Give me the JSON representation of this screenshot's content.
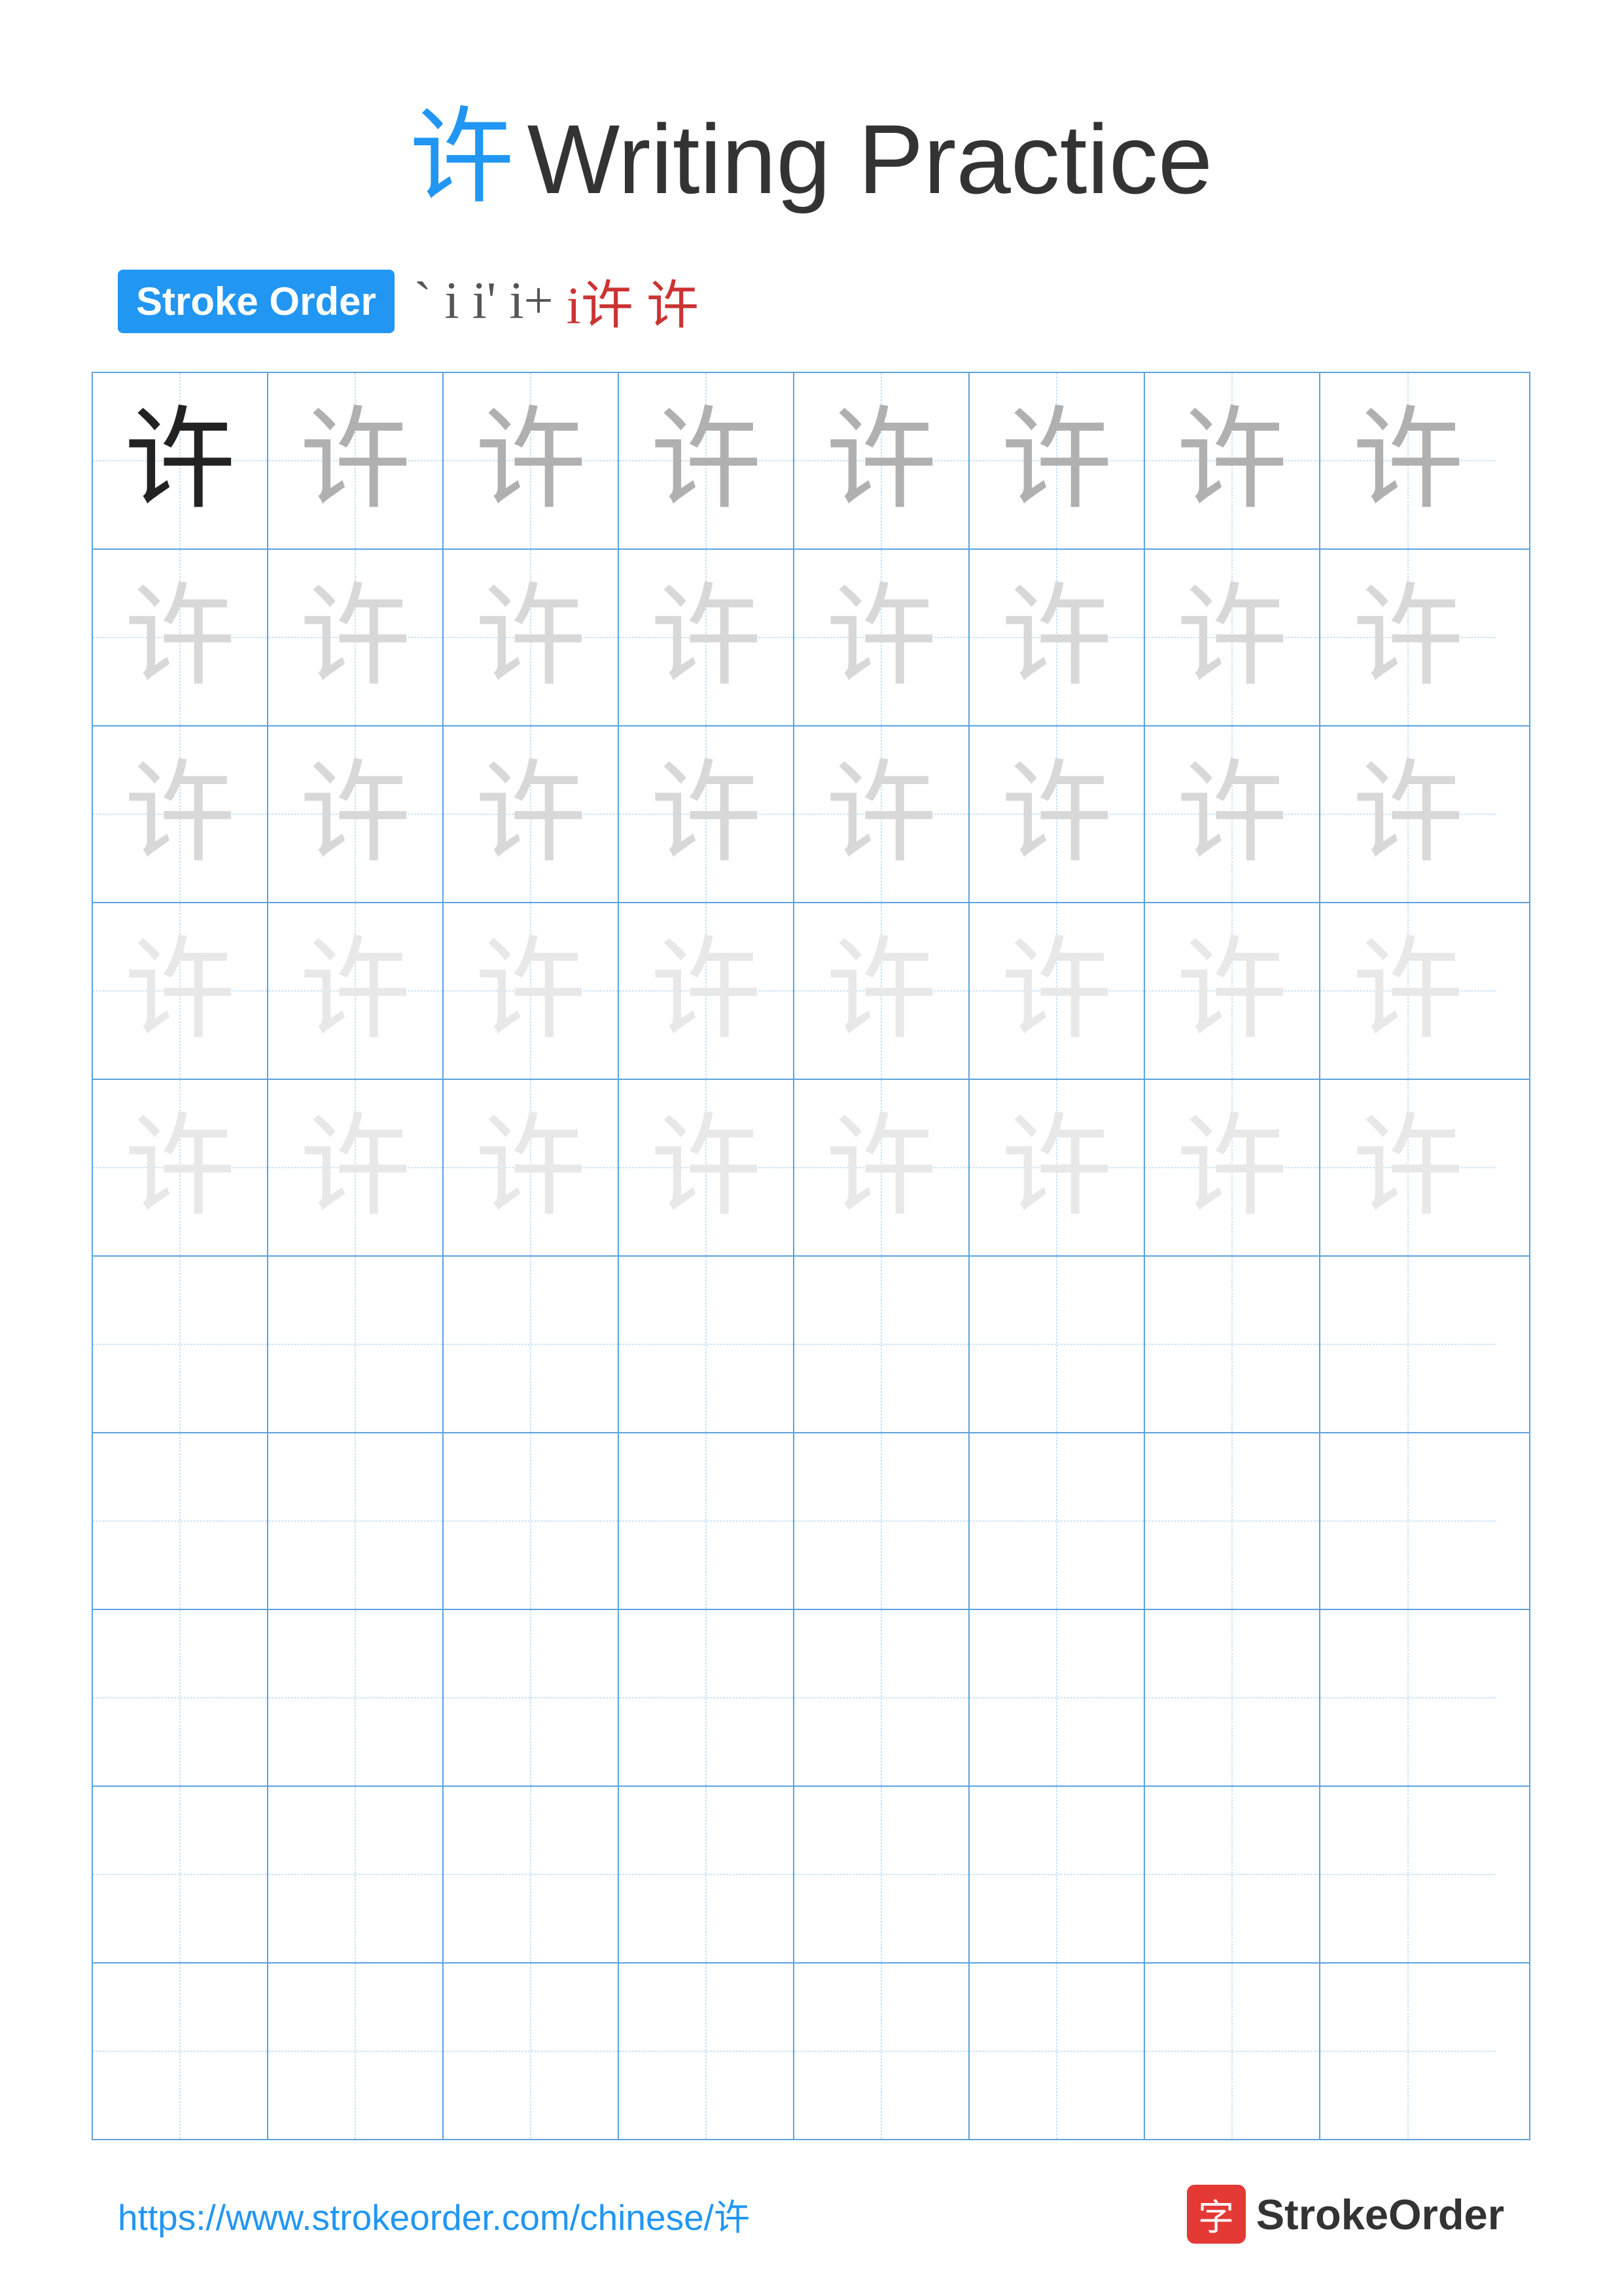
{
  "page": {
    "title_char": "许",
    "title_text": "Writing Practice",
    "stroke_order_label": "Stroke Order",
    "stroke_sequence": [
      "` ",
      "i",
      "i'",
      "i+",
      "i许",
      "许"
    ],
    "char": "许",
    "footer_url": "https://www.strokeorder.com/chinese/许",
    "footer_brand": "StrokeOrder",
    "footer_icon": "字"
  },
  "grid": {
    "rows": 10,
    "cols": 8,
    "char_rows": [
      [
        "dark",
        "medium",
        "medium",
        "medium",
        "medium",
        "medium",
        "medium",
        "medium"
      ],
      [
        "light",
        "light",
        "light",
        "light",
        "light",
        "light",
        "light",
        "light"
      ],
      [
        "light",
        "light",
        "light",
        "light",
        "light",
        "light",
        "light",
        "light"
      ],
      [
        "very-light",
        "very-light",
        "very-light",
        "very-light",
        "very-light",
        "very-light",
        "very-light",
        "very-light"
      ],
      [
        "very-light",
        "very-light",
        "very-light",
        "very-light",
        "very-light",
        "very-light",
        "very-light",
        "very-light"
      ],
      [
        "none",
        "none",
        "none",
        "none",
        "none",
        "none",
        "none",
        "none"
      ],
      [
        "none",
        "none",
        "none",
        "none",
        "none",
        "none",
        "none",
        "none"
      ],
      [
        "none",
        "none",
        "none",
        "none",
        "none",
        "none",
        "none",
        "none"
      ],
      [
        "none",
        "none",
        "none",
        "none",
        "none",
        "none",
        "none",
        "none"
      ],
      [
        "none",
        "none",
        "none",
        "none",
        "none",
        "none",
        "none",
        "none"
      ]
    ]
  }
}
